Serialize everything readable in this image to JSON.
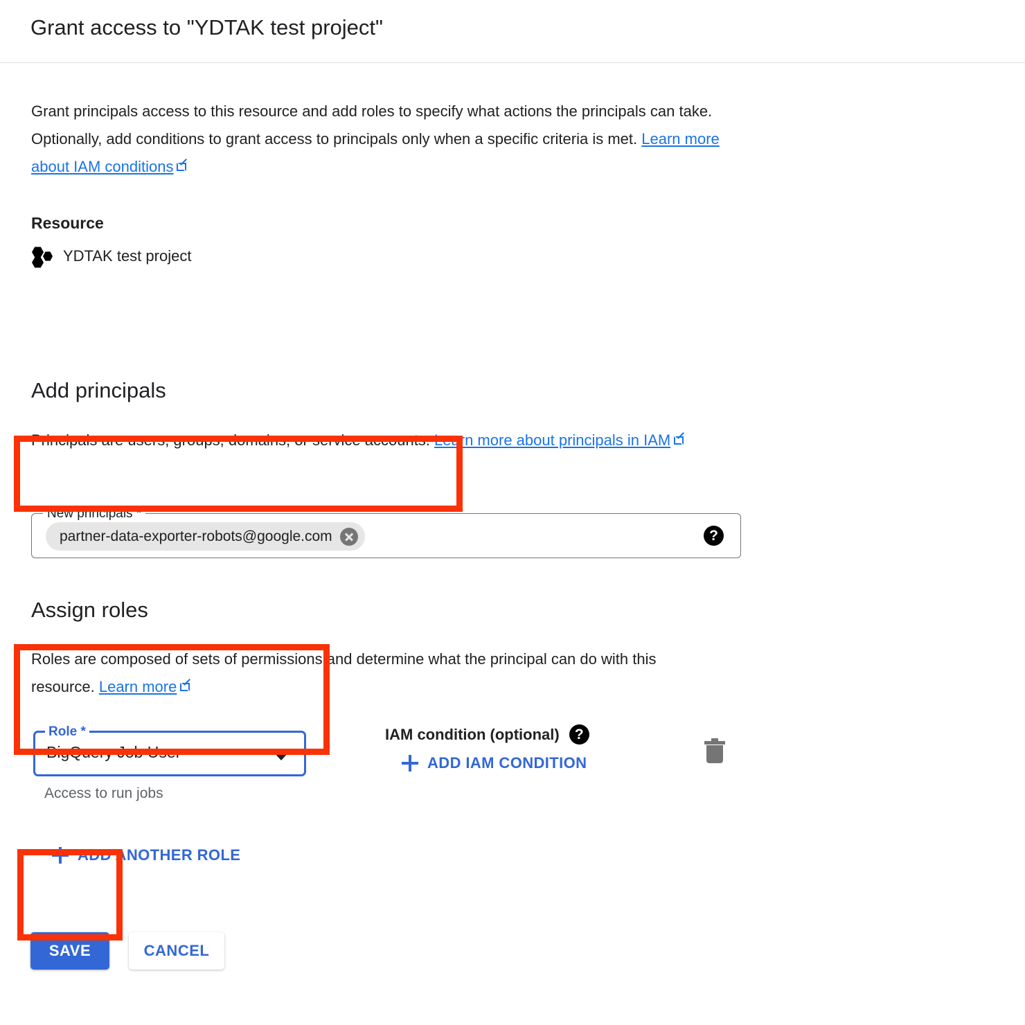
{
  "dialog": {
    "title": "Grant access to \"YDTAK test project\"",
    "intro": {
      "text": "Grant principals access to this resource and add roles to specify what actions the principals can take. Optionally, add conditions to grant access to principals only when a specific criteria is met.",
      "link_label": "Learn more about IAM conditions",
      "link_icon": "external-link-icon"
    }
  },
  "resource": {
    "heading": "Resource",
    "icon": "gcp-project-icon",
    "name": "YDTAK test project"
  },
  "add_principals": {
    "heading": "Add principals",
    "description": "Principals are users, groups, domains, or service accounts.",
    "link_label": "Learn more about principals in IAM",
    "link_icon": "external-link-icon",
    "field": {
      "label": "New principals *",
      "chips": [
        {
          "value": "partner-data-exporter-robots@google.com",
          "remove_icon": "close-circle-icon"
        }
      ],
      "help_icon": "help-circle-icon"
    }
  },
  "assign_roles": {
    "heading": "Assign roles",
    "description": "Roles are composed of sets of permissions and determine what the principal can do with this resource.",
    "link_label": "Learn more",
    "link_icon": "external-link-icon",
    "role_field": {
      "label": "Role *",
      "value": "BigQuery Job User",
      "hint": "Access to run jobs",
      "dropdown_icon": "chevron-down-icon"
    },
    "iam_condition": {
      "label": "IAM condition (optional)",
      "help_icon": "help-circle-icon",
      "add_label": "ADD IAM CONDITION",
      "add_icon": "plus-icon"
    },
    "delete_icon": "trash-icon",
    "add_another_role_label": "ADD ANOTHER ROLE",
    "add_another_role_icon": "plus-icon"
  },
  "actions": {
    "save_label": "SAVE",
    "cancel_label": "CANCEL"
  },
  "colors": {
    "accent_blue": "#1a73e8",
    "button_blue": "#3367d6",
    "highlight_red": "#fa3205",
    "hint_gray": "#5f6368",
    "chip_gray": "#e6e6e6",
    "border_gray": "#757575"
  }
}
